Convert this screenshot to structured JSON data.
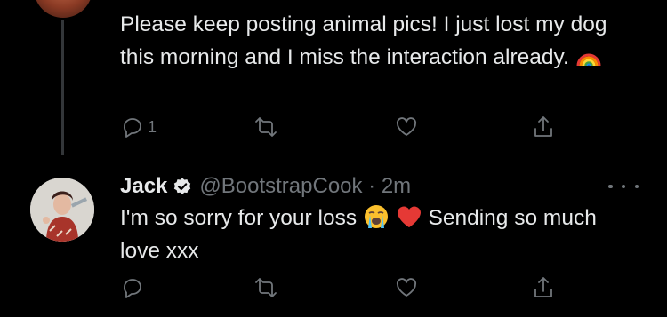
{
  "tweet1": {
    "text": "Please keep posting animal pics! I just lost my dog this morning and I miss the interaction already.",
    "emoji": "rainbow-emoji",
    "reply_count": "1"
  },
  "tweet2": {
    "author_name": "Jack",
    "handle_time": "@BootstrapCook · 2m",
    "text_part1": "I'm so sorry for your loss",
    "text_part2": "Sending so much love xxx",
    "emojis": [
      "loudly-crying-face-emoji",
      "red-heart-emoji"
    ]
  },
  "colors": {
    "background": "#000000",
    "text": "#e7e9ea",
    "secondary": "#71767b",
    "thread_line": "#333639"
  }
}
